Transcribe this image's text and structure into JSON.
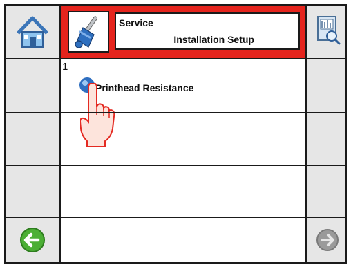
{
  "header": {
    "title_line1": "Service",
    "title_line2": "Installation Setup"
  },
  "list": {
    "items": [
      {
        "number": "1",
        "label": "Printhead Resistance"
      }
    ]
  },
  "icons": {
    "home": "home-icon",
    "service_tool": "service-tool-icon",
    "report": "report-magnifier-icon",
    "back": "left-arrow-icon",
    "forward": "right-arrow-icon",
    "selection": "radio-selected-icon",
    "touch": "pointing-hand-icon"
  },
  "colors": {
    "header_frame": "#e5241d",
    "back_arrow": "#4caf35",
    "forward_arrow_disabled": "#9a9a9a",
    "radio": "#2f6fc0"
  }
}
